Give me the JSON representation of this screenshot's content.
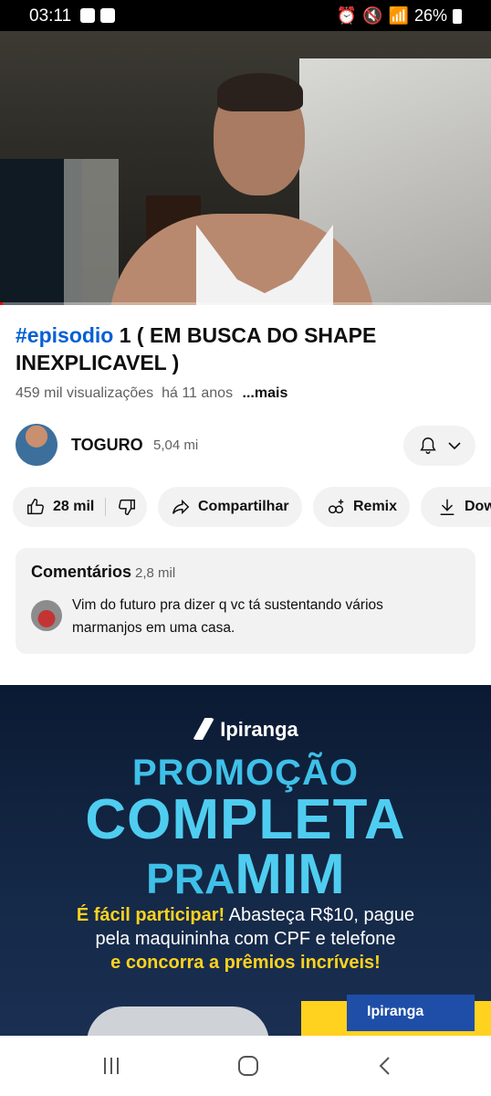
{
  "status_bar": {
    "time": "03:11",
    "battery": "26%"
  },
  "video": {
    "title_hashtag": "#episodio",
    "title_rest": " 1 ( EM BUSCA DO SHAPE INEXPLICAVEL )",
    "views": "459 mil visualizações",
    "age": "há 11 anos",
    "more": "...mais"
  },
  "channel": {
    "name": "TOGURO",
    "subscribers": "5,04 mi"
  },
  "actions": {
    "likes": "28 mil",
    "share": "Compartilhar",
    "remix": "Remix",
    "download": "Download"
  },
  "comments": {
    "title": "Comentários",
    "count": "2,8 mil",
    "top_comment": "Vim do futuro pra dizer q vc tá sustentando vários marmanjos em uma casa."
  },
  "ad": {
    "brand": "Ipiranga",
    "line1": "PROMOÇÃO",
    "line2": "COMPLETA",
    "line3a": "PRA",
    "line3b": "MIM",
    "line4_highlight": "É fácil participar!",
    "line4_rest": " Abasteça R$10, pague",
    "line5": "pela maquininha com CPF e telefone",
    "line6": "e concorra a prêmios incríveis!",
    "station_sign": "Ipiranga"
  },
  "colors": {
    "accent_link": "#065fd4",
    "pill_bg": "#f2f2f2",
    "ad_cyan": "#4fcdf0",
    "ad_yellow": "#ffd21f"
  }
}
